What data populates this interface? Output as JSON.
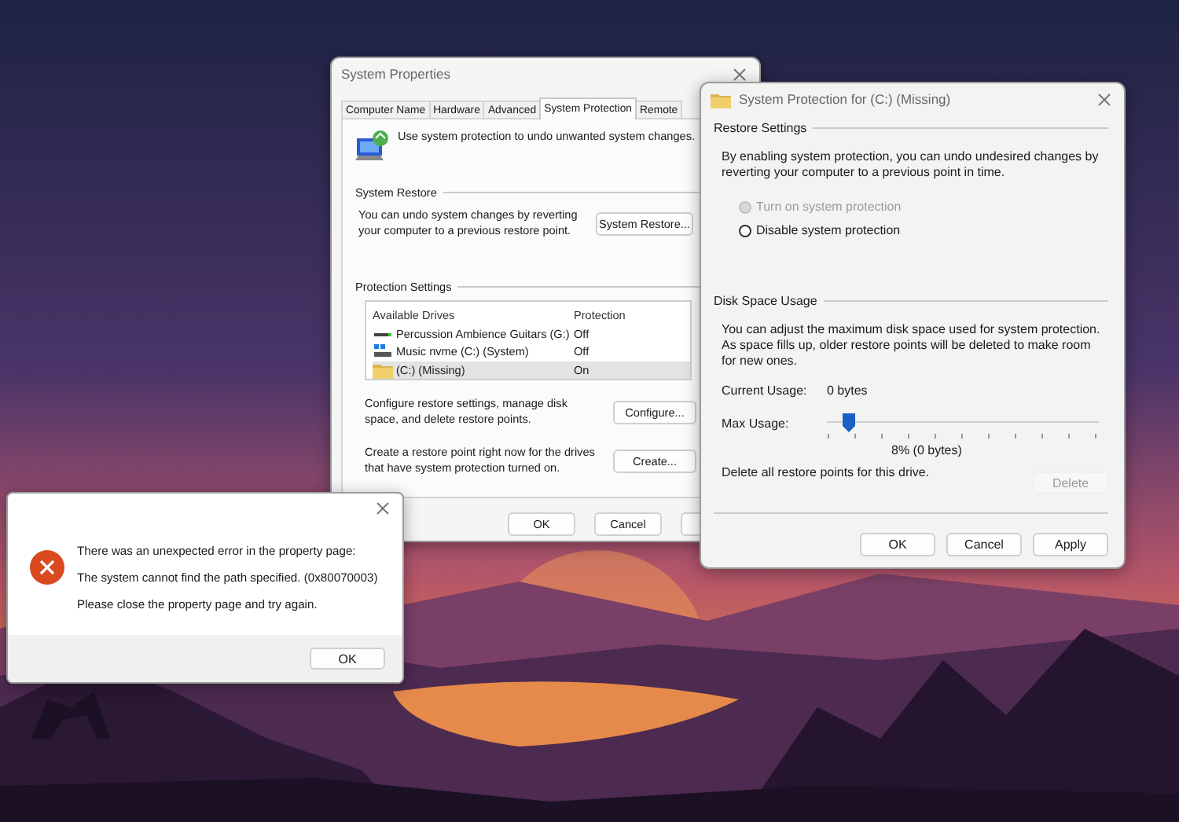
{
  "system_properties": {
    "title": "System Properties",
    "tabs": [
      {
        "label": "Computer Name",
        "selected": false
      },
      {
        "label": "Hardware",
        "selected": false
      },
      {
        "label": "Advanced",
        "selected": false
      },
      {
        "label": "System Protection",
        "selected": true
      },
      {
        "label": "Remote",
        "selected": false
      }
    ],
    "intro": "Use system protection to undo unwanted system changes.",
    "system_restore": {
      "heading": "System Restore",
      "text": "You can undo system changes by reverting your computer to a previous restore point.",
      "button": "System Restore..."
    },
    "protection_settings": {
      "heading": "Protection Settings",
      "columns": [
        "Available Drives",
        "Protection"
      ],
      "drives": [
        {
          "kind": "external",
          "name": "Percussion Ambience Guitars (G:)",
          "protection": "Off",
          "selected": false
        },
        {
          "kind": "system",
          "name": "Music nvme (C:) (System)",
          "protection": "Off",
          "selected": false
        },
        {
          "kind": "folder",
          "name": "(C:) (Missing)",
          "protection": "On",
          "selected": true
        }
      ],
      "actions": [
        {
          "text": "Configure restore settings, manage disk space, and delete restore points.",
          "button": "Configure..."
        },
        {
          "text": "Create a restore point right now for the drives that have system protection turned on.",
          "button": "Create..."
        }
      ]
    },
    "buttons": [
      "OK",
      "Cancel"
    ]
  },
  "system_protection": {
    "title": "System Protection for (C:) (Missing)",
    "restore_settings": {
      "heading": "Restore Settings",
      "text": "By enabling system protection, you can undo undesired changes by reverting your computer to a previous point in time.",
      "options": [
        {
          "label": "Turn on system protection",
          "selected": false,
          "disabled": true
        },
        {
          "label": "Disable system protection",
          "selected": false,
          "disabled": false
        }
      ]
    },
    "disk_space_usage": {
      "heading": "Disk Space Usage",
      "text": "You can adjust the maximum disk space used for system protection. As space fills up, older restore points will be deleted to make room for new ones.",
      "current_usage_label": "Current Usage:",
      "current_usage": "0 bytes",
      "max_usage_label": "Max Usage:",
      "max_usage": {
        "level": 0.08,
        "reading": "8% (0 bytes)"
      },
      "delete_text": "Delete all restore points for this drive.",
      "delete_button": {
        "label": "Delete",
        "disabled": true
      }
    },
    "buttons": [
      "OK",
      "Cancel",
      "Apply"
    ]
  },
  "error_dialog": {
    "messages": [
      "There was an unexpected error in the property page:",
      "The system cannot find the path specified. (0x80070003)",
      "Please close the property page and try again."
    ],
    "button": "OK"
  }
}
